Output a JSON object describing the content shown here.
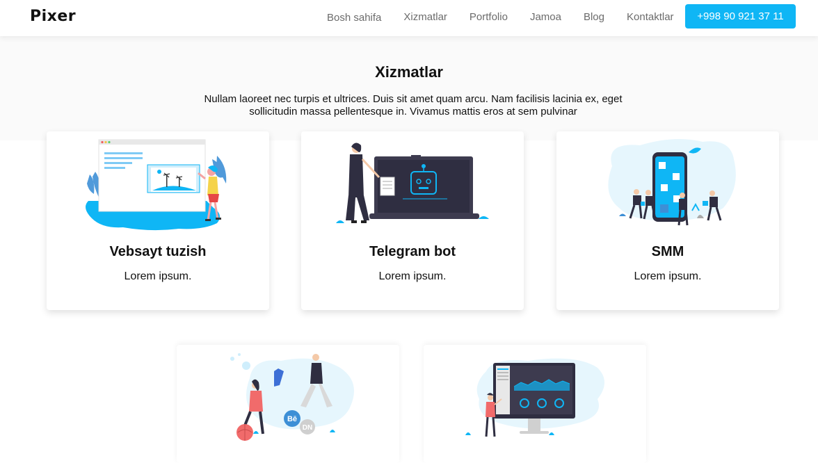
{
  "brand": {
    "logo": "Pixer",
    "accent": "#0fb6f5"
  },
  "nav": {
    "items": [
      "Bosh sahifa",
      "Xizmatlar",
      "Portfolio",
      "Jamoa",
      "Blog",
      "Kontaktlar"
    ],
    "phone": "+998 90 921 37 11"
  },
  "services": {
    "title": "Xizmatlar",
    "description_line1": "Nullam laoreet nec turpis et ultrices. Duis sit amet quam arcu. Nam facilisis lacinia ex, eget",
    "description_line2": "sollicitudin massa pellentesque in. Vivamus mattis eros at sem pulvinar",
    "cards": [
      {
        "title": "Vebsayt tuzish",
        "text": "Lorem ipsum.",
        "icon": "web-design-illustration"
      },
      {
        "title": "Telegram bot",
        "text": "Lorem ipsum.",
        "icon": "telegram-bot-illustration"
      },
      {
        "title": "SMM",
        "text": "Lorem ipsum.",
        "icon": "smm-illustration"
      },
      {
        "title": "",
        "text": "",
        "icon": "design-portfolio-illustration"
      },
      {
        "title": "",
        "text": "",
        "icon": "analytics-dashboard-illustration"
      }
    ]
  }
}
